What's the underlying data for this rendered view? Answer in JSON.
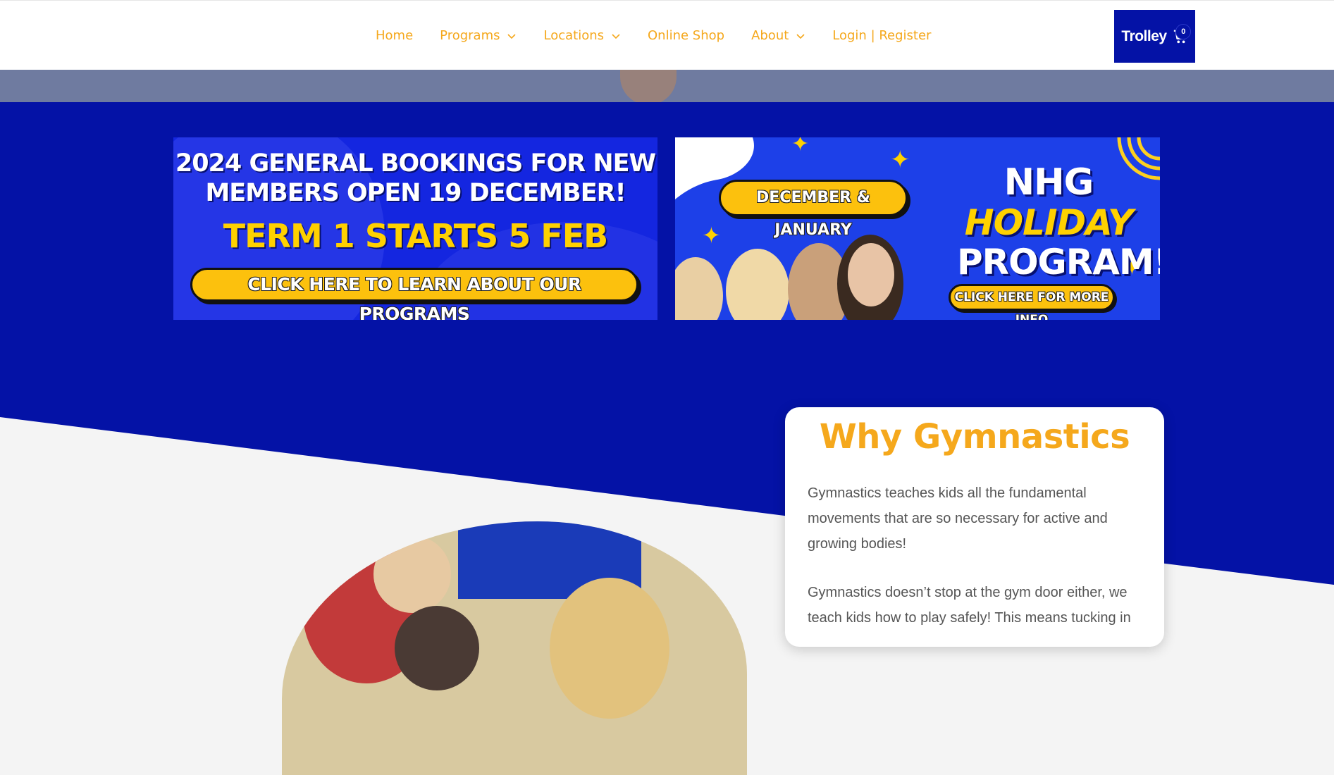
{
  "nav": {
    "items": [
      {
        "label": "Home",
        "has_dropdown": false
      },
      {
        "label": "Programs",
        "has_dropdown": true
      },
      {
        "label": "Locations",
        "has_dropdown": true
      },
      {
        "label": "Online Shop",
        "has_dropdown": false
      },
      {
        "label": "About",
        "has_dropdown": true
      },
      {
        "label": "Login | Register",
        "has_dropdown": false
      }
    ],
    "trolley_label": "Trolley",
    "trolley_count": "0",
    "icon": "cart-icon"
  },
  "banner_left": {
    "title_line1": "2024 GENERAL BOOKINGS FOR NEW",
    "title_line2": "MEMBERS OPEN 19 DECEMBER!",
    "highlight": "TERM 1 STARTS 5 FEB",
    "cta": "CLICK HERE TO LEARN ABOUT OUR PROGRAMS"
  },
  "banner_right": {
    "dates": "DECEMBER & JANUARY",
    "line1": "NHG",
    "line2": "HOLIDAY",
    "line3": "PROGRAM!",
    "cta": "CLICK HERE FOR MORE INFO"
  },
  "why": {
    "heading": "Why Gymnastics",
    "para1": "Gymnastics teaches kids all the fundamental movements that are so necessary for active and growing bodies!",
    "para2": "Gymnastics doesn’t stop at the gym door either, we teach kids how to play safely! This means tucking in"
  },
  "colors": {
    "brand_blue": "#0412a6",
    "accent_orange": "#f5a81c",
    "banner_yellow": "#ffd100"
  }
}
